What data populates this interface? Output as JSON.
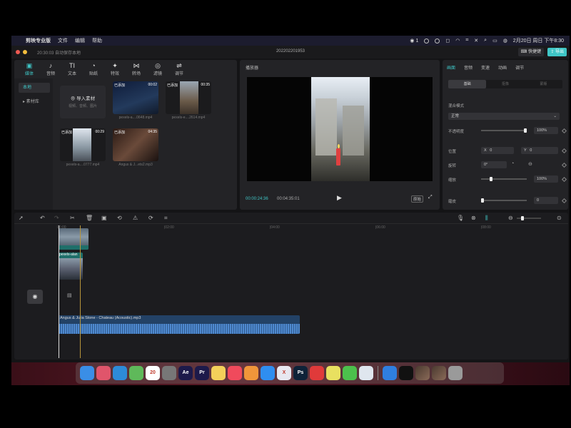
{
  "menubar": {
    "app_name": "剪映专业版",
    "items": [
      "文件",
      "编辑",
      "帮助"
    ],
    "wechat_badge": "1",
    "datetime": "2月20日 周日 下午8:30"
  },
  "titlebar": {
    "left_text": "20:30:03 自动保存本地",
    "project_title": "202202201953",
    "shortcut_button": "快捷键",
    "export_button": "导出"
  },
  "media_panel": {
    "tabs": [
      {
        "label": "媒体",
        "icon": "▣"
      },
      {
        "label": "音频",
        "icon": "♪"
      },
      {
        "label": "文本",
        "icon": "TI"
      },
      {
        "label": "贴纸",
        "icon": "◔"
      },
      {
        "label": "特效",
        "icon": "✦"
      },
      {
        "label": "转场",
        "icon": "⋈"
      },
      {
        "label": "滤镜",
        "icon": "◎"
      },
      {
        "label": "调节",
        "icon": "⇌"
      }
    ],
    "side_items": [
      "本地",
      "素材库"
    ],
    "import": {
      "label": "导入素材",
      "hint": "视频、音频、图片"
    },
    "clips": [
      {
        "added": "已添加",
        "duration": "00:02",
        "name": "pexels-a....0648.mp4"
      },
      {
        "added": "已添加",
        "duration": "00:35",
        "name": "pexels-e....2614.mp4"
      },
      {
        "added": "已添加",
        "duration": "00:29",
        "name": "pexels-a....0777.mp4"
      },
      {
        "added": "已添加",
        "duration": "04:35",
        "name": "Angus & J...ets2.mp3"
      }
    ]
  },
  "player": {
    "title": "播放器",
    "current_time": "00:00:24:36",
    "total_time": "00:04:35:01",
    "ratio_button": "原始"
  },
  "properties": {
    "tabs": [
      "画面",
      "音频",
      "变速",
      "动画",
      "调节"
    ],
    "subtabs": [
      "基础",
      "抠像",
      "蒙版"
    ],
    "blend_mode_label": "混合模式",
    "blend_mode_value": "正常",
    "opacity_label": "不透明度",
    "opacity_value": "100%",
    "opacity_level": 1.0,
    "position_label": "位置",
    "pos_x_label": "X",
    "pos_x": "0",
    "pos_y_label": "Y",
    "pos_y": "0",
    "rotate_label": "旋转",
    "rotate_value": "0°",
    "scale_label": "缩放",
    "scale_value": "100%",
    "scale_level": 0.2,
    "saturation_label": "磨皮",
    "saturation_value": "0",
    "saturation_level": 0.0
  },
  "timeline": {
    "ruler_ticks": [
      "00:00",
      "|02:00",
      "|04:00",
      "|06:00",
      "|08:00"
    ],
    "video_clip_label": "pexels-alan",
    "audio_clip_label": "Angus & Julia Stone - Chateau (Acoustic).mp3"
  },
  "dock": {
    "calendar_day": "20",
    "apps": [
      {
        "name": "finder-icon",
        "label": "",
        "color": "#3a8ee6"
      },
      {
        "name": "launchpad-icon",
        "label": "",
        "color": "#e0556b"
      },
      {
        "name": "safari-icon",
        "label": "",
        "color": "#2d8bd8"
      },
      {
        "name": "maps-icon",
        "label": "",
        "color": "#5fb95a"
      },
      {
        "name": "calendar-icon",
        "label": "20",
        "color": "#ffffff"
      },
      {
        "name": "settings-icon",
        "label": "",
        "color": "#777777"
      },
      {
        "name": "after-effects-icon",
        "label": "Ae",
        "color": "#1d1a4a"
      },
      {
        "name": "premiere-icon",
        "label": "Pr",
        "color": "#1d1a4a"
      },
      {
        "name": "notes-icon",
        "label": "",
        "color": "#f3d05a"
      },
      {
        "name": "music-icon",
        "label": "",
        "color": "#f04a5c"
      },
      {
        "name": "pages-icon",
        "label": "",
        "color": "#f0963a"
      },
      {
        "name": "app-store-icon",
        "label": "",
        "color": "#2f8ef0"
      },
      {
        "name": "xcode-icon",
        "label": "X",
        "color": "#e8e8f0"
      },
      {
        "name": "photoshop-icon",
        "label": "Ps",
        "color": "#0e2238"
      },
      {
        "name": "netease-icon",
        "label": "",
        "color": "#e03a3a"
      },
      {
        "name": "qq-icon",
        "label": "",
        "color": "#e8e060"
      },
      {
        "name": "wechat-icon",
        "label": "",
        "color": "#4cc04c"
      },
      {
        "name": "preview-icon",
        "label": "",
        "color": "#dfe6ee"
      },
      {
        "name": "capcut-blue-icon",
        "label": "",
        "color": "#2f7fe0"
      },
      {
        "name": "capcut-icon",
        "label": "",
        "color": "#111111"
      }
    ]
  }
}
